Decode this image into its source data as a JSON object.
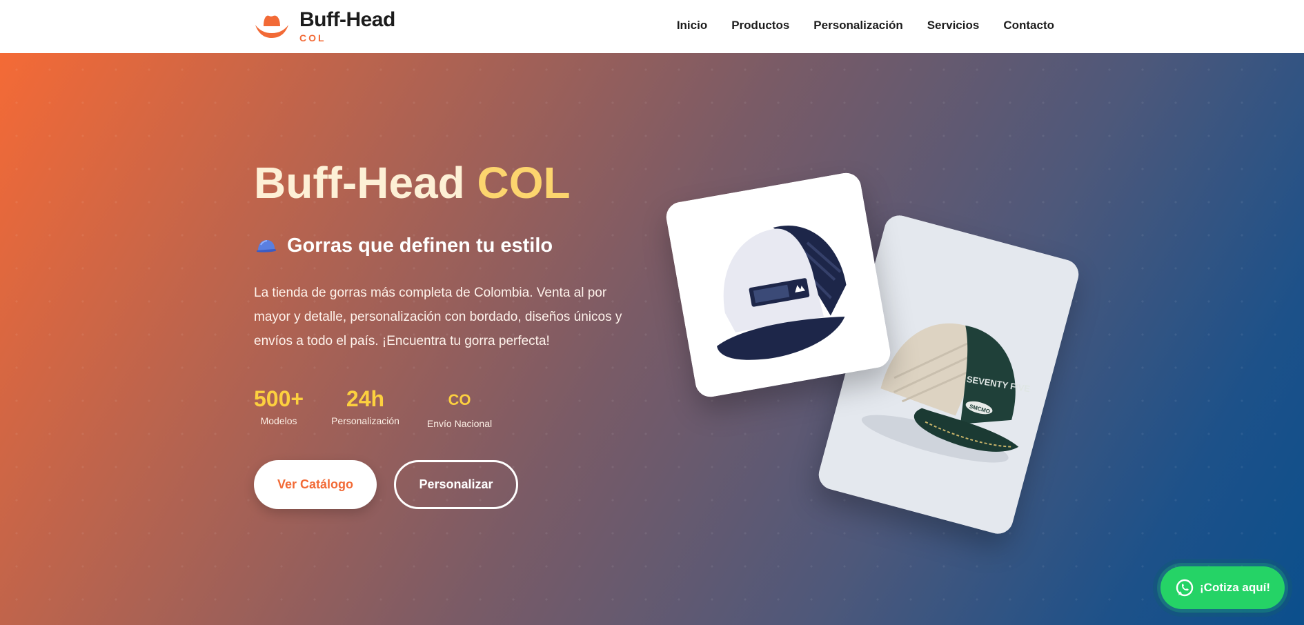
{
  "brand": {
    "name": "Buff-Head",
    "sub": "COL",
    "logo_icon": "cowboy-hat-icon",
    "accent": "#f26a36"
  },
  "nav": {
    "items": [
      {
        "label": "Inicio"
      },
      {
        "label": "Productos"
      },
      {
        "label": "Personalización"
      },
      {
        "label": "Servicios"
      },
      {
        "label": "Contacto"
      }
    ]
  },
  "hero": {
    "title_part1": "Buff-Head",
    "title_part2": "COL",
    "subtitle_icon": "cap-icon",
    "subtitle": "Gorras que definen tu estilo",
    "description": "La tienda de gorras más completa de Colombia. Venta al por mayor y detalle, personalización con bordado, diseños únicos y envíos a todo el país. ¡Encuentra tu gorra perfecta!",
    "stats": [
      {
        "value": "500+",
        "label": "Modelos"
      },
      {
        "value": "24h",
        "label": "Personalización"
      },
      {
        "value": "CO",
        "label": "Envío Nacional"
      }
    ],
    "primary_button": "Ver Catálogo",
    "secondary_button": "Personalizar",
    "gradient_start": "#f46a36",
    "gradient_end": "#0b4f8c",
    "title_highlight_color": "#fcd56e",
    "stat_color": "#fcd03f"
  },
  "products": {
    "card1_icon": "trucker-cap-navy-white",
    "card2_icon": "trucker-cap-green-beige",
    "card2_cap_text": "SEVENTY FIVE",
    "card2_badge_text": "SMCMO"
  },
  "whatsapp": {
    "label": "¡Cotiza aquí!",
    "icon": "whatsapp-icon",
    "color": "#25d366"
  }
}
